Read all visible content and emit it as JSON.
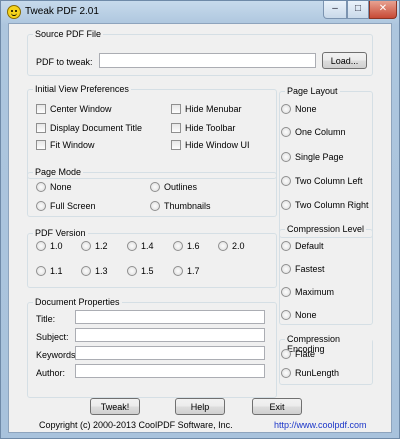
{
  "window": {
    "title": "Tweak PDF 2.01",
    "controls": {
      "minimize": "–",
      "maximize": "□",
      "close": "✕"
    }
  },
  "source": {
    "group_label": "Source PDF File",
    "field_label": "PDF to tweak:",
    "field_value": "",
    "load_button": "Load..."
  },
  "initial_view": {
    "group_label": "Initial View Preferences",
    "options": [
      {
        "label": "Center Window",
        "checked": false
      },
      {
        "label": "Display Document Title",
        "checked": false
      },
      {
        "label": "Fit Window",
        "checked": false
      },
      {
        "label": "Hide Menubar",
        "checked": false
      },
      {
        "label": "Hide Toolbar",
        "checked": false
      },
      {
        "label": "Hide Window UI",
        "checked": false
      }
    ]
  },
  "page_layout": {
    "group_label": "Page Layout",
    "options": [
      "None",
      "One Column",
      "Single Page",
      "Two Column Left",
      "Two Column Right"
    ]
  },
  "page_mode": {
    "group_label": "Page Mode",
    "options": [
      "None",
      "Full Screen",
      "Outlines",
      "Thumbnails"
    ]
  },
  "pdf_version": {
    "group_label": "PDF Version",
    "options": [
      "1.0",
      "1.2",
      "1.4",
      "1.6",
      "2.0",
      "1.1",
      "1.3",
      "1.5",
      "1.7"
    ]
  },
  "compression_level": {
    "group_label": "Compression Level",
    "options": [
      "Default",
      "Fastest",
      "Maximum",
      "None"
    ]
  },
  "document_properties": {
    "group_label": "Document Properties",
    "fields": [
      {
        "label": "Title:",
        "value": ""
      },
      {
        "label": "Subject:",
        "value": ""
      },
      {
        "label": "Keywords:",
        "value": ""
      },
      {
        "label": "Author:",
        "value": ""
      }
    ]
  },
  "compression_encoding": {
    "group_label": "Compression Encoding",
    "options": [
      "Flate",
      "RunLength"
    ]
  },
  "actions": {
    "tweak": "Tweak!",
    "help": "Help",
    "exit": "Exit"
  },
  "footer": {
    "copyright": "Copyright (c) 2000-2013 CoolPDF Software, Inc.",
    "link": "http://www.coolpdf.com"
  }
}
